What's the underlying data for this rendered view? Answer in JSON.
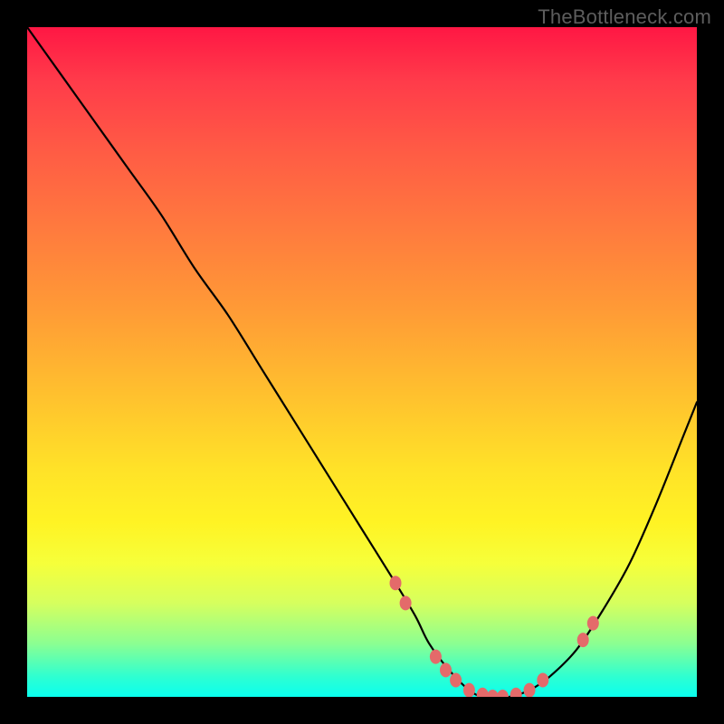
{
  "watermark": "TheBottleneck.com",
  "chart_data": {
    "type": "line",
    "title": "",
    "xlabel": "",
    "ylabel": "",
    "xlim": [
      0,
      100
    ],
    "ylim": [
      0,
      100
    ],
    "grid": false,
    "legend": false,
    "series": [
      {
        "name": "curve",
        "x": [
          0,
          5,
          10,
          15,
          20,
          25,
          30,
          35,
          40,
          45,
          50,
          55,
          58,
          60,
          63,
          66,
          68,
          70,
          72,
          75,
          78,
          82,
          86,
          90,
          94,
          98,
          100
        ],
        "y": [
          100,
          93,
          86,
          79,
          72,
          64,
          57,
          49,
          41,
          33,
          25,
          17,
          12,
          8,
          4,
          1,
          0,
          0,
          0,
          1,
          3,
          7,
          13,
          20,
          29,
          39,
          44
        ],
        "color": "#000000"
      }
    ],
    "markers": [
      {
        "x": 55,
        "y": 17
      },
      {
        "x": 56.5,
        "y": 14
      },
      {
        "x": 61,
        "y": 6
      },
      {
        "x": 62.5,
        "y": 4
      },
      {
        "x": 64,
        "y": 2.5
      },
      {
        "x": 66,
        "y": 1
      },
      {
        "x": 68,
        "y": 0.3
      },
      {
        "x": 69.5,
        "y": 0
      },
      {
        "x": 71,
        "y": 0
      },
      {
        "x": 73,
        "y": 0.3
      },
      {
        "x": 75,
        "y": 1
      },
      {
        "x": 77,
        "y": 2.5
      },
      {
        "x": 83,
        "y": 8.5
      },
      {
        "x": 84.5,
        "y": 11
      }
    ],
    "marker_color": "#e46a6a"
  }
}
